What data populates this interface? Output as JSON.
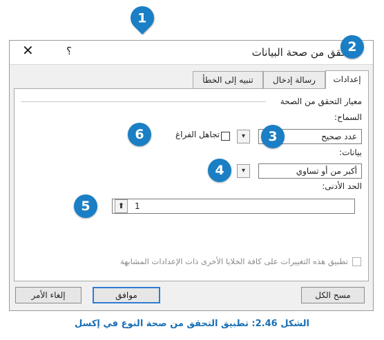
{
  "dialog": {
    "title": "تحقق من صحة البيانات",
    "help_glyph": "؟",
    "close_glyph": "✕"
  },
  "tabs": [
    {
      "label": "إعدادات",
      "active": true
    },
    {
      "label": "رسالة إدخال",
      "active": false
    },
    {
      "label": "تنبيه إلى الخطأ",
      "active": false
    }
  ],
  "settings": {
    "group_label": "معيار التحقق من الصحة",
    "allow_label": "السماح:",
    "allow_value": "عدد صحيح",
    "ignore_blank_label": "تجاهل الفراغ",
    "ignore_blank_checked": false,
    "data_label": "بيانات:",
    "data_value": "أكبر من أو تساوي",
    "minimum_label": "الحد الأدنى:",
    "minimum_value": "1",
    "apply_all_label": "تطبيق هذه التغييرات على كافة الخلايا الأخرى ذات الإعدادات المشابهة",
    "apply_all_checked": false
  },
  "buttons": {
    "clear_all": "مسح الكل",
    "ok": "موافق",
    "cancel": "إلغاء الأمر"
  },
  "callouts": [
    "1",
    "2",
    "3",
    "4",
    "5",
    "6"
  ],
  "caption": "الشكل 2.46: تطبيق التحقق من صحة النوع في إكسل",
  "colors": {
    "callout": "#1a7fc4",
    "caption": "#1a6fb5",
    "primary_border": "#2f7bd0"
  },
  "icons": {
    "dropdown": "chevron-down-icon",
    "collapse": "range-selector-icon"
  }
}
